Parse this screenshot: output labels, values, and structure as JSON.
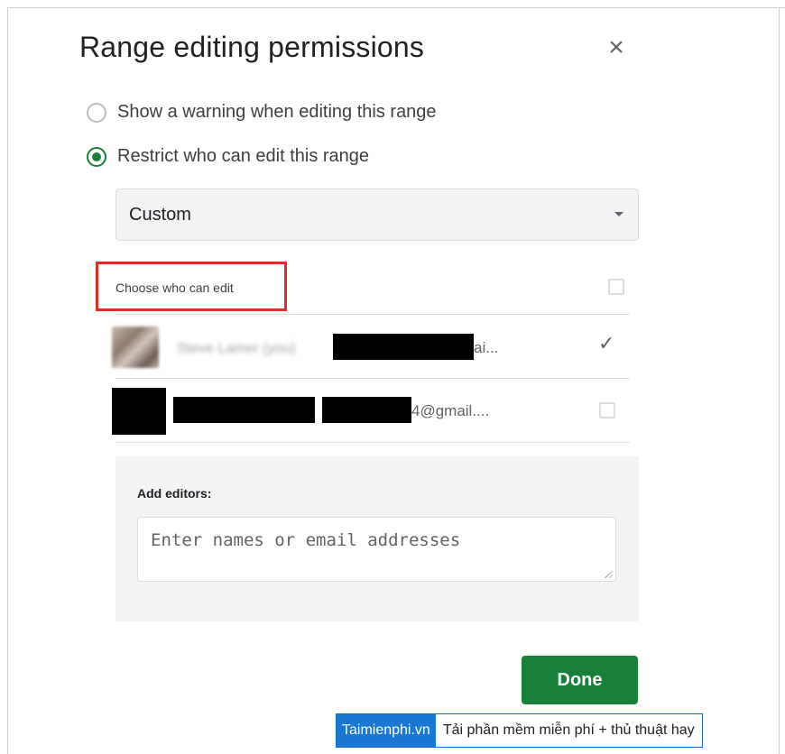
{
  "dialog": {
    "title": "Range editing permissions",
    "close_glyph": "×"
  },
  "options": [
    {
      "label": "Show a warning when editing this range",
      "selected": false
    },
    {
      "label": "Restrict who can edit this range",
      "selected": true
    }
  ],
  "permission_select": {
    "value": "Custom"
  },
  "editors_header": {
    "label": "Choose who can edit",
    "checked": false
  },
  "editors": [
    {
      "email_suffix": "ai...",
      "checked": true
    },
    {
      "email_suffix": "4@gmail....",
      "checked": false
    }
  ],
  "add_editors": {
    "label": "Add editors:",
    "placeholder": "Enter names or email addresses"
  },
  "done_button": {
    "label": "Done"
  },
  "watermark": {
    "brand": "Taimienphi.vn",
    "slogan": "Tải phần mềm miễn phí + thủ thuật hay"
  },
  "colors": {
    "primary_green": "#188038",
    "highlight_red": "#d93025",
    "panel_gray": "#f1f3f4"
  }
}
